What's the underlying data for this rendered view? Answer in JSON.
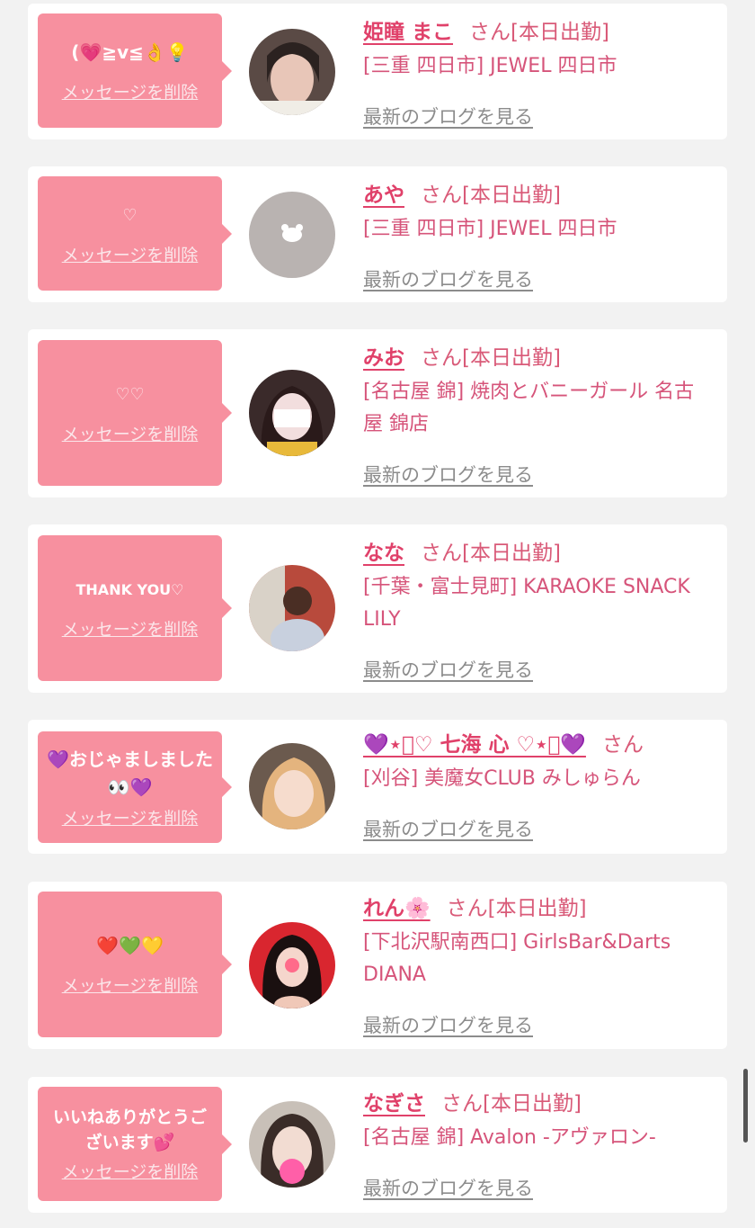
{
  "delete_label": "メッセージを削除",
  "blog_label": "最新のブログを見る",
  "san_suffix": "さん",
  "items": [
    {
      "message": "(💗≧v≦👌💡",
      "name": "姫瞳 まこ",
      "status": "[本日出勤]",
      "shop": "[三重 四日市] JEWEL 四日市",
      "avatar": "photo-girl-1"
    },
    {
      "message": "♡",
      "name": "あや",
      "status": "[本日出勤]",
      "shop": "[三重 四日市] JEWEL 四日市",
      "avatar": "default-avatar"
    },
    {
      "message": "♡♡",
      "name": "みお",
      "status": "[本日出勤]",
      "shop": "[名古屋 錦] 焼肉とバニーガール 名古屋 錦店",
      "avatar": "photo-girl-3"
    },
    {
      "message": "THANK YOU♡",
      "name": "なな",
      "status": "[本日出勤]",
      "shop": "[千葉・富士見町] KARAOKE SNACK LILY",
      "avatar": "photo-girl-4"
    },
    {
      "message": "💜おじゃましました👀💜",
      "name": "💜⋆͛♡ 七海 心 ♡⋆͛💜",
      "status": "",
      "shop": "[刈谷] 美魔女CLUB みしゅらん",
      "avatar": "photo-girl-5"
    },
    {
      "message": "❤️💚💛",
      "name": "れん🌸",
      "status": "[本日出勤]",
      "shop": "[下北沢駅南西口] GirlsBar&Darts DIANA",
      "avatar": "photo-girl-6"
    },
    {
      "message": "いいねありがとうございます💕",
      "name": "なぎさ",
      "status": "[本日出勤]",
      "shop": "[名古屋 錦] Avalon -アヴァロン-",
      "avatar": "photo-girl-7"
    }
  ]
}
